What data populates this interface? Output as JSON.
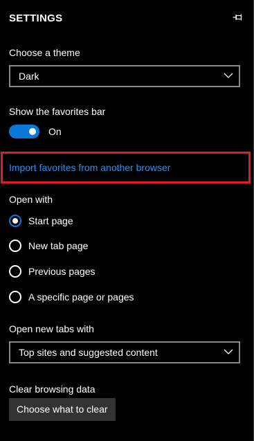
{
  "panel": {
    "title": "SETTINGS",
    "accent_color": "#0a78d7",
    "link_color": "#2e8ee6",
    "highlight_color": "#e21b24",
    "pin_icon": "pin-icon"
  },
  "theme": {
    "label": "Choose a theme",
    "selected": "Dark"
  },
  "favorites_bar": {
    "label": "Show the favorites bar",
    "state": "On"
  },
  "import_link": "Import favorites from another browser",
  "open_with": {
    "label": "Open with",
    "options": [
      "Start page",
      "New tab page",
      "Previous pages",
      "A specific page or pages"
    ],
    "selected": "Start page"
  },
  "new_tabs": {
    "label": "Open new tabs with",
    "selected": "Top sites and suggested content"
  },
  "clear_data": {
    "label": "Clear browsing data",
    "button": "Choose what to clear"
  }
}
